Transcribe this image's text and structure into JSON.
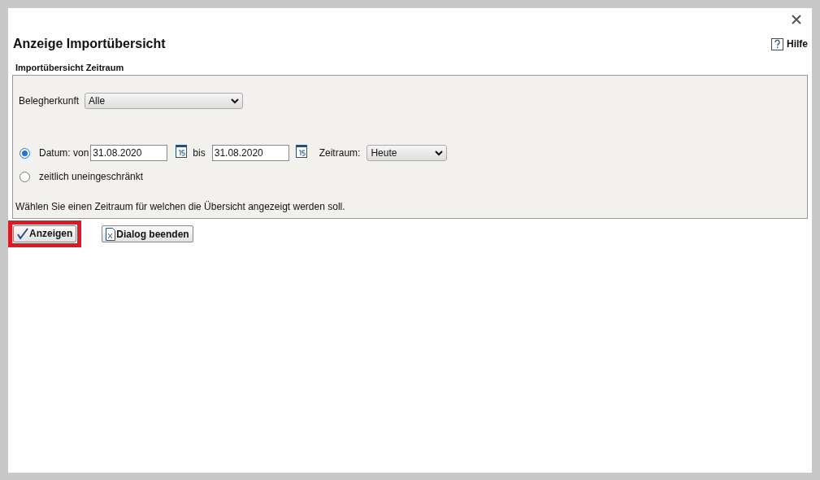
{
  "dialog": {
    "title": "Anzeige Importübersicht",
    "help": "Hilfe"
  },
  "section": {
    "title": "Importübersicht Zeitraum",
    "origin": {
      "label": "Belegherkunft",
      "value": "Alle"
    },
    "options": [
      {
        "kind": "range",
        "selected": true,
        "label": "Datum: von",
        "from": "31.08.2020",
        "to_label": "bis",
        "to": "31.08.2020",
        "period_label": "Zeitraum:",
        "period": "Heute"
      },
      {
        "kind": "plain",
        "selected": false,
        "label": "zeitlich uneingeschränkt"
      }
    ],
    "hint": "Wählen Sie einen Zeitraum für welchen die Übersicht angezeigt werden soll."
  },
  "buttons": [
    {
      "kind": "check",
      "label": "Anzeigen",
      "highlighted": true
    },
    {
      "kind": "close",
      "label": "Dialog beenden",
      "highlighted": false
    }
  ]
}
